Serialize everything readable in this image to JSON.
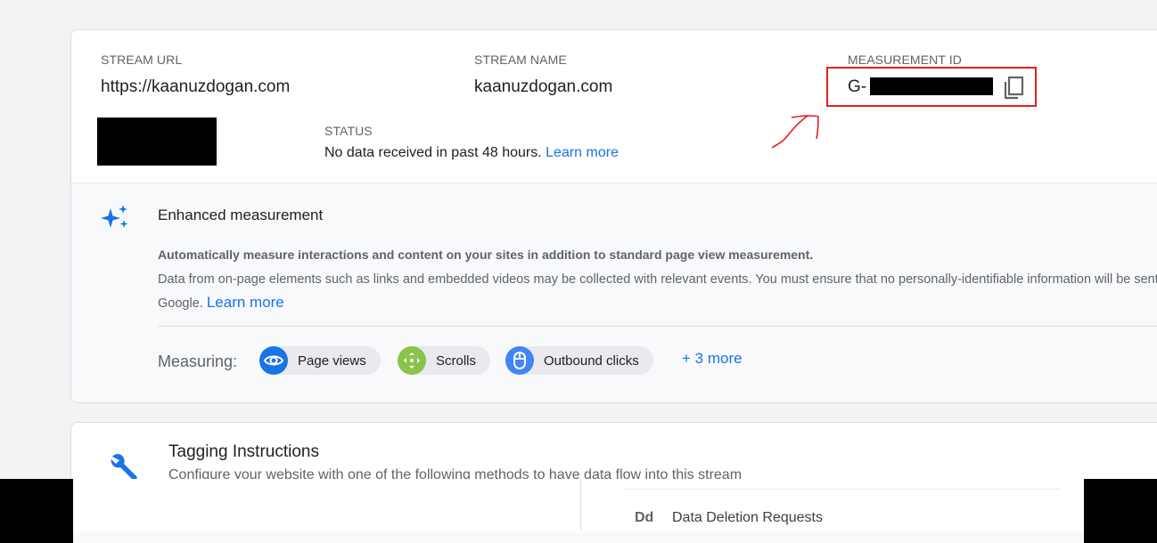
{
  "stream": {
    "url_label": "STREAM URL",
    "url_value": "https://kaanuzdogan.com",
    "name_label": "STREAM NAME",
    "name_value": "kaanuzdogan.com",
    "measurement_label": "MEASUREMENT ID",
    "measurement_value": "G-",
    "status_label": "STATUS",
    "status_text": "No data received in past 48 hours.",
    "status_link": "Learn more"
  },
  "enhanced": {
    "title": "Enhanced measurement",
    "desc_bold": "Automatically measure interactions and content on your sites in addition to standard page view measurement.",
    "desc_text": "Data from on-page elements such as links and embedded videos may be collected with relevant events. You must ensure that no personally-identifiable information will be sent to Google.",
    "desc_link": "Learn more",
    "measuring_label": "Measuring:",
    "chips": [
      {
        "label": "Page views",
        "icon": "eye-icon",
        "color": "#1a73e8"
      },
      {
        "label": "Scrolls",
        "icon": "scroll-icon",
        "color": "#8bc34a"
      },
      {
        "label": "Outbound clicks",
        "icon": "mouse-icon",
        "color": "#4285f4"
      }
    ],
    "more_link": "+ 3 more"
  },
  "tagging": {
    "title": "Tagging Instructions",
    "desc": "Configure your website with one of the following methods to have data flow into this stream"
  },
  "popup": {
    "icon_text": "Dd",
    "item_label": "Data Deletion Requests"
  },
  "colors": {
    "accent": "#1a73e8",
    "annotation_red": "#e41e1e"
  }
}
